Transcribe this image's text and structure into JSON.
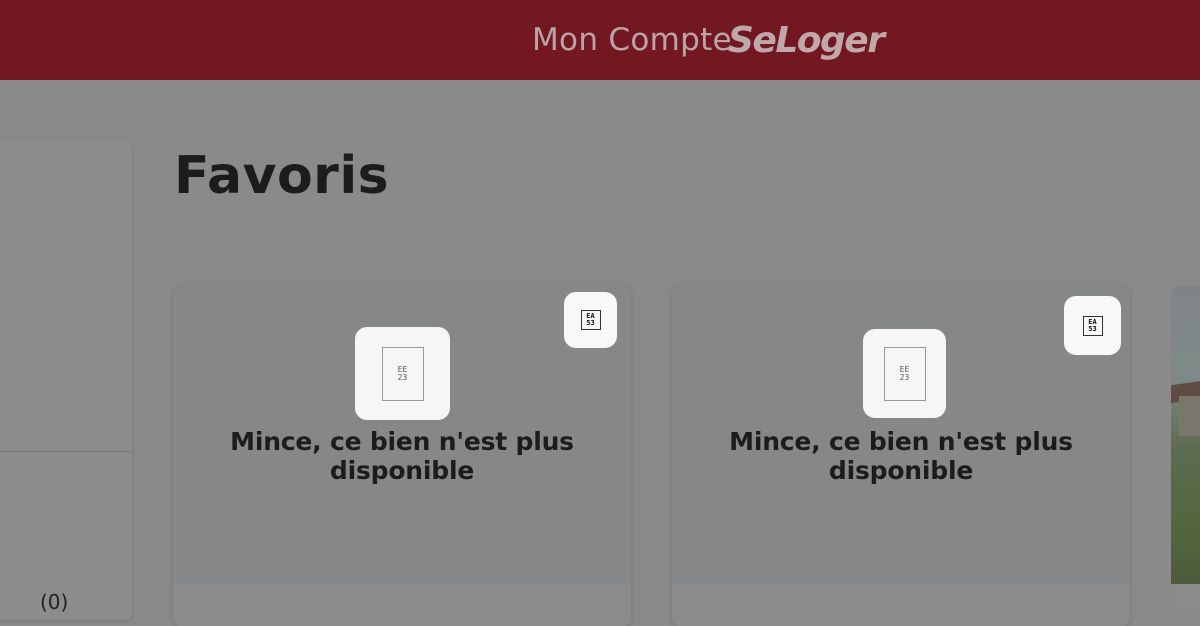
{
  "header": {
    "account_label": "Mon Compte",
    "logo_text": "SeLoger",
    "background": "#731820"
  },
  "sidebar": {
    "count_label": "(0)"
  },
  "main": {
    "title": "Favoris",
    "cards": [
      {
        "message": "Mince, ce bien n'est plus disponible",
        "placeholder_glyph": "EE\n23",
        "icon_glyph": "EA\n53",
        "icon": "grid-code-icon"
      },
      {
        "message": "Mince, ce bien n'est plus disponible",
        "placeholder_glyph": "EE\n23",
        "icon_glyph": "EA\n53",
        "icon": "grid-code-icon"
      },
      {
        "image": "house-photo"
      }
    ]
  }
}
